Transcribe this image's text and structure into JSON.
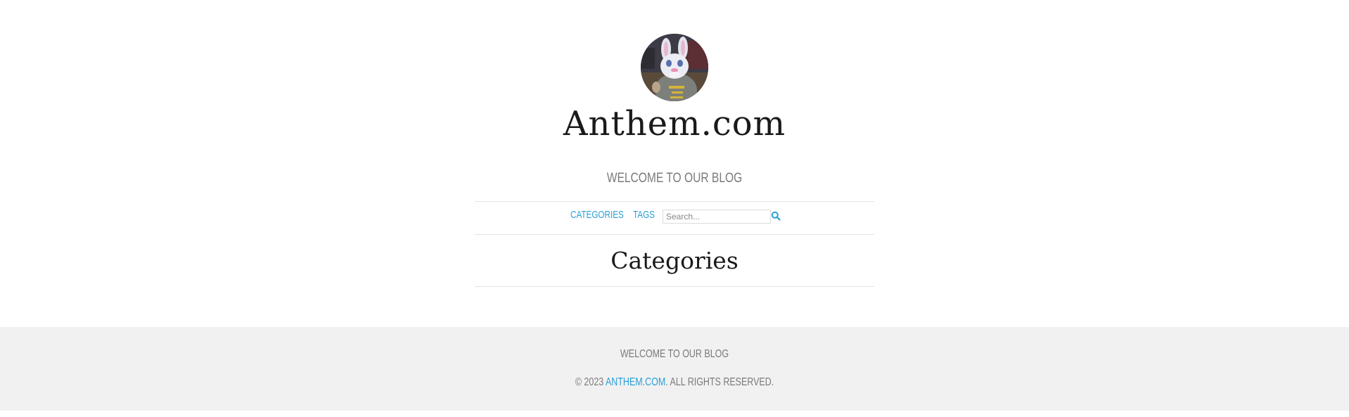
{
  "header": {
    "site_title": "Anthem.com",
    "tagline": "WELCOME TO OUR BLOG",
    "avatar_icon": "avatar-image"
  },
  "nav": {
    "items": [
      {
        "label": "CATEGORIES"
      },
      {
        "label": "TAGS"
      }
    ],
    "search": {
      "placeholder": "Search...",
      "value": "",
      "button_icon": "search-icon"
    }
  },
  "main": {
    "heading": "Categories"
  },
  "footer": {
    "tagline": "WELCOME TO OUR BLOG",
    "copyright_prefix": "© 2023 ",
    "site_link": "ANTHEM.COM",
    "copyright_suffix": ". ALL RIGHTS RESERVED."
  },
  "colors": {
    "accent": "#2a9fd6",
    "muted_text": "#7a7a7a",
    "footer_bg": "#f1f1f1",
    "rule": "#e4e4e4"
  }
}
